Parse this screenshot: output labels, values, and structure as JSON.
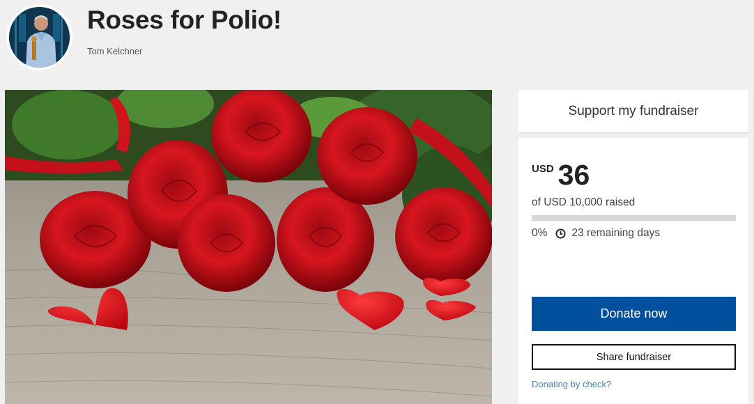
{
  "header": {
    "title": "Roses for Polio!",
    "owner": "Tom Kelchner"
  },
  "panel": {
    "heading": "Support my fundraiser",
    "currency": "USD",
    "amount": "36",
    "goal_text": "of USD 10,000 raised",
    "progress_percent": 0,
    "percent_text": "0%",
    "remaining_text": "23 remaining days",
    "donate_label": "Donate now",
    "share_label": "Share fundraiser",
    "check_link": "Donating by check?"
  },
  "icons": {
    "clock": "clock-icon"
  },
  "colors": {
    "primary": "#00509d",
    "background": "#f0f0f0",
    "link": "#4a7fb0"
  }
}
